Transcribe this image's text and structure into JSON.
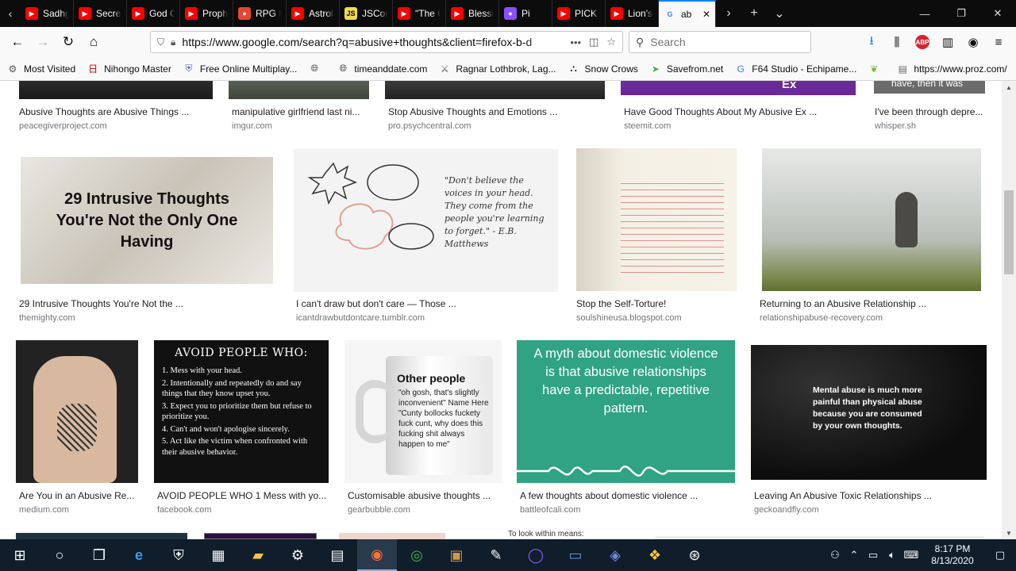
{
  "tabs": [
    {
      "label": "Sadhg",
      "icon": "youtube-icon",
      "color": "#ff0000"
    },
    {
      "label": "Secret",
      "icon": "youtube-icon",
      "color": "#ff0000"
    },
    {
      "label": "God C",
      "icon": "youtube-icon",
      "color": "#ff0000"
    },
    {
      "label": "Proph",
      "icon": "youtube-icon",
      "color": "#ff0000"
    },
    {
      "label": "RPG N",
      "icon": "rpg-icon",
      "color": "#e8452c"
    },
    {
      "label": "Astrol",
      "icon": "youtube-icon",
      "color": "#ff0000"
    },
    {
      "label": "JSCom",
      "icon": "js-icon",
      "color": "#f0db4f"
    },
    {
      "label": "\"The C",
      "icon": "youtube-icon",
      "color": "#ff0000"
    },
    {
      "label": "Blessin",
      "icon": "youtube-icon",
      "color": "#ff0000"
    },
    {
      "label": "Pi",
      "icon": "pi-icon",
      "color": "#8a4fff"
    },
    {
      "label": "PICK A",
      "icon": "youtube-icon",
      "color": "#ff0000"
    },
    {
      "label": "Lion's",
      "icon": "youtube-icon",
      "color": "#ff0000"
    },
    {
      "label": "ab",
      "icon": "google-icon",
      "color": "#4285f4",
      "active": true
    }
  ],
  "url": "https://www.google.com/search?q=abusive+thoughts&client=firefox-b-d",
  "search_placeholder": "Search",
  "bookmarks": [
    {
      "label": "Most Visited",
      "icon": "gear-icon"
    },
    {
      "label": "Nihongo Master",
      "icon": "nihongo-icon"
    },
    {
      "label": "Free Online Multiplay...",
      "icon": "shield-icon"
    },
    {
      "label": "",
      "icon": "globe-icon"
    },
    {
      "label": "timeanddate.com",
      "icon": "globe-icon"
    },
    {
      "label": "Ragnar Lothbrok, Lag...",
      "icon": "vikings-icon"
    },
    {
      "label": "Snow Crows",
      "icon": "crow-icon"
    },
    {
      "label": "Savefrom.net",
      "icon": "arrow-icon"
    },
    {
      "label": "F64 Studio - Echipame...",
      "icon": "google-icon"
    },
    {
      "label": "",
      "icon": "leaf-icon"
    },
    {
      "label": "https://www.proz.com/",
      "icon": "page-icon"
    }
  ],
  "results": {
    "row1": [
      {
        "caption": "Abusive Thoughts are Abusive Things ...",
        "source": "peacegiverproject.com"
      },
      {
        "caption": "manipulative girlfriend last ni...",
        "source": "imgur.com"
      },
      {
        "caption": "Stop Abusive Thoughts and Emotions ...",
        "source": "pro.psychcentral.com"
      },
      {
        "caption": "Have Good Thoughts About My Abusive Ex ...",
        "source": "steemit.com",
        "image_text": "Ex"
      },
      {
        "caption": "I've been through depre...",
        "source": "whisper.sh",
        "image_text": "have, then it was"
      }
    ],
    "row2": [
      {
        "caption": "29 Intrusive Thoughts You're Not the ...",
        "source": "themighty.com",
        "image_text": "29 Intrusive Thoughts You're Not the Only One Having"
      },
      {
        "caption": "I can't draw but don't care — Those ...",
        "source": "icantdrawbutdontcare.tumblr.com",
        "image_text": "\"Don't believe the voices in your head. They come from the people you're learning to forget.\" - E.B. Matthews"
      },
      {
        "caption": "Stop the Self-Torture!",
        "source": "soulshineusa.blogspot.com"
      },
      {
        "caption": "Returning to an Abusive Relationship ...",
        "source": "relationshipabuse-recovery.com"
      }
    ],
    "row3": [
      {
        "caption": "Are You in an Abusive Re...",
        "source": "medium.com"
      },
      {
        "caption": "AVOID PEOPLE WHO 1 Mess with yo...",
        "source": "facebook.com",
        "image_title": "AVOID PEOPLE WHO:",
        "image_lines": [
          "1. Mess with your head.",
          "2. Intentionally and repeatedly do and say things that they know upset you.",
          "3. Expect you to prioritize them but refuse to prioritize you.",
          "4. Can't and won't apologise sincerely.",
          "5. Act like the victim when confronted with their abusive behavior."
        ]
      },
      {
        "caption": "Customisable abusive thoughts ...",
        "source": "gearbubble.com",
        "image_title": "Other people",
        "image_text": "\"oh gosh, that's slightly inconvenient\" Name Here \"Cunty bollocks fuckety fuck cunt, why does this fucking shit always happen to me\""
      },
      {
        "caption": "A few thoughts about domestic violence ...",
        "source": "battleofcali.com",
        "image_text": "A myth about domestic violence is that abusive relationships have a predictable, repetitive pattern."
      },
      {
        "caption": "Leaving An Abusive Toxic Relationships ...",
        "source": "geckoandfly.com",
        "image_text": "Mental abuse is much more painful than physical abuse because you are consumed by your own thoughts."
      }
    ],
    "row4_partial_text": "To look within means:"
  },
  "taskbar": {
    "time": "8:17 PM",
    "date": "8/13/2020"
  }
}
